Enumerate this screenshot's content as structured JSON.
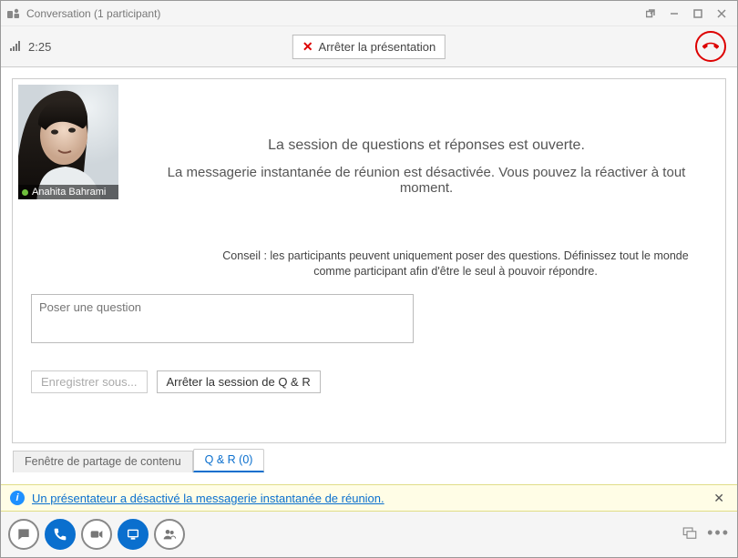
{
  "window": {
    "title": "Conversation (1 participant)"
  },
  "status": {
    "time": "2:25"
  },
  "stop_presentation": {
    "label": "Arrêter la présentation"
  },
  "participant": {
    "name": "Anahita Bahrami"
  },
  "messages": {
    "qna_open": "La session de questions et réponses est ouverte.",
    "im_disabled": "La messagerie instantanée de réunion est désactivée. Vous pouvez la réactiver à tout moment.",
    "tip": "Conseil : les participants peuvent uniquement poser des questions. Définissez tout le monde comme participant afin d'être le seul à pouvoir répondre."
  },
  "question_input": {
    "placeholder": "Poser une question"
  },
  "buttons": {
    "save_as": "Enregistrer sous...",
    "stop_qna": "Arrêter la session de Q & R"
  },
  "tabs": {
    "content_share": "Fenêtre de partage de contenu",
    "qna": "Q & R (0)"
  },
  "infobar": {
    "message": "Un présentateur a désactivé la messagerie instantanée de réunion."
  }
}
